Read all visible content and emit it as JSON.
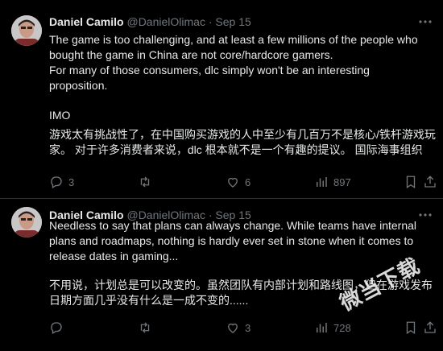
{
  "tweets": [
    {
      "author": {
        "name": "Daniel Camilo",
        "handle": "@DanielOlimac"
      },
      "separator": "·",
      "date": "Sep 15",
      "text_en": "The game is too challenging, and at least a few millions of the people who\nbought the game in China are not core/hardcore gamers.\nFor many of those consumers, dlc simply won't be an interesting\nproposition.",
      "text_imo": "IMO",
      "text_cn": "游戏太有挑战性了，在中国购买游戏的人中至少有几百万不是核心/铁杆游戏玩\n家。 对于许多消费者来说，dlc 根本就不是一个有趣的提议。 国际海事组织",
      "stats": {
        "replies": "3",
        "retweets": "",
        "likes": "6",
        "views": "897"
      }
    },
    {
      "author": {
        "name": "Daniel Camilo",
        "handle": "@DanielOlimac"
      },
      "separator": "·",
      "date": "Sep 15",
      "text_en": "Needless to say that plans can always change. While teams have internal\nplans and roadmaps, nothing is hardly ever set in stone when it comes to\nrelease dates in gaming...",
      "text_cn": "不用说，计划总是可以改变的。虽然团队有内部计划和路线图，但在游戏发布\n日期方面几乎没有什么是一成不变的......",
      "stats": {
        "replies": "",
        "retweets": "",
        "likes": "3",
        "views": "728"
      }
    }
  ],
  "watermark": "微当下载",
  "colors": {
    "background": "#000000",
    "text": "#e7e9ea",
    "muted": "#71767b",
    "divider": "#2f3336"
  }
}
